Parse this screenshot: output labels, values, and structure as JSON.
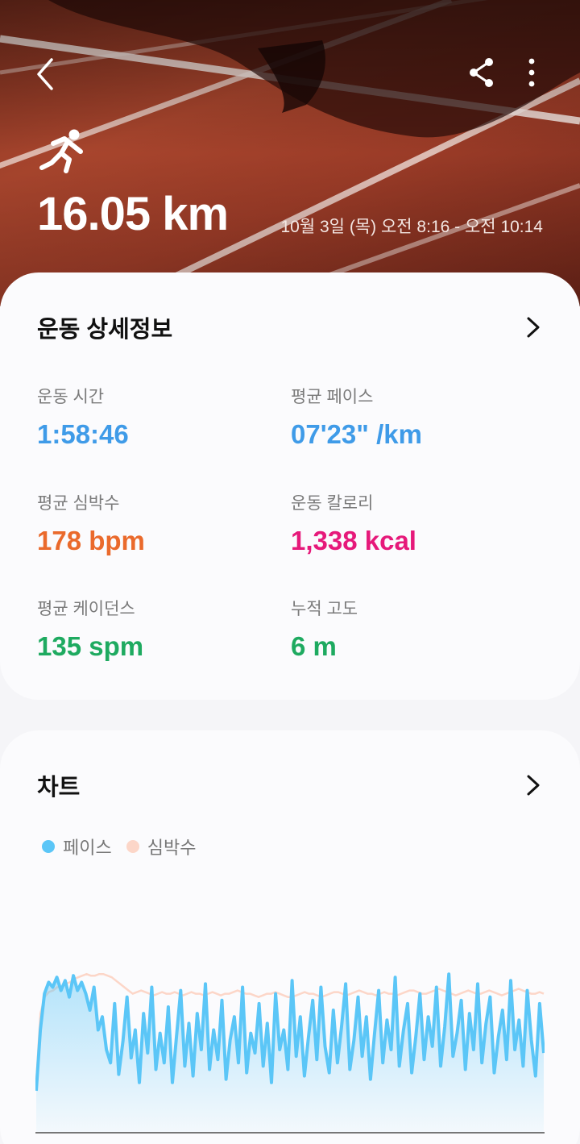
{
  "colors": {
    "pace": "#3f9be8",
    "heart": "#ea6a2c",
    "calorie": "#e6197a",
    "green": "#1eaa60",
    "legend_pace": "#5bc6f7",
    "legend_heart": "#fcd6c8"
  },
  "header": {
    "back_icon": "chevron-left-icon",
    "share_icon": "share-icon",
    "more_icon": "more-vertical-icon",
    "activity_icon": "running-icon",
    "distance": "16.05 km",
    "timerange": "10월 3일 (목) 오전 8:16 - 오전 10:14"
  },
  "details": {
    "title": "운동 상세정보",
    "stats": [
      {
        "label": "운동 시간",
        "value": "1:58:46",
        "color": "#3f9be8"
      },
      {
        "label": "평균 페이스",
        "value": "07'23\" /km",
        "color": "#3f9be8"
      },
      {
        "label": "평균 심박수",
        "value": "178 bpm",
        "color": "#ea6a2c"
      },
      {
        "label": "운동 칼로리",
        "value": "1,338 kcal",
        "color": "#e6197a"
      },
      {
        "label": "평균 케이던스",
        "value": "135 spm",
        "color": "#1eaa60"
      },
      {
        "label": "누적 고도",
        "value": "6 m",
        "color": "#1eaa60"
      }
    ]
  },
  "chart": {
    "title": "차트",
    "legend": [
      "페이스",
      "심박수"
    ]
  },
  "chart_data": {
    "type": "line",
    "title": "",
    "xlabel": "",
    "ylabel": "",
    "grid": false,
    "legend_position": "top-left",
    "series": [
      {
        "name": "페이스",
        "values": [
          0.25,
          0.62,
          0.84,
          0.91,
          0.88,
          0.94,
          0.86,
          0.92,
          0.82,
          0.95,
          0.86,
          0.91,
          0.84,
          0.74,
          0.88,
          0.62,
          0.7,
          0.5,
          0.42,
          0.78,
          0.35,
          0.55,
          0.82,
          0.45,
          0.62,
          0.3,
          0.72,
          0.48,
          0.88,
          0.38,
          0.6,
          0.42,
          0.76,
          0.3,
          0.58,
          0.86,
          0.4,
          0.66,
          0.34,
          0.72,
          0.5,
          0.9,
          0.38,
          0.62,
          0.44,
          0.8,
          0.32,
          0.56,
          0.7,
          0.42,
          0.88,
          0.36,
          0.6,
          0.48,
          0.78,
          0.4,
          0.66,
          0.3,
          0.84,
          0.5,
          0.62,
          0.38,
          0.92,
          0.46,
          0.7,
          0.34,
          0.58,
          0.8,
          0.44,
          0.88,
          0.52,
          0.36,
          0.74,
          0.42,
          0.64,
          0.9,
          0.38,
          0.56,
          0.82,
          0.46,
          0.7,
          0.32,
          0.6,
          0.86,
          0.42,
          0.68,
          0.5,
          0.94,
          0.4,
          0.62,
          0.78,
          0.36,
          0.58,
          0.84,
          0.44,
          0.7,
          0.52,
          0.88,
          0.4,
          0.64,
          0.96,
          0.46,
          0.6,
          0.8,
          0.38,
          0.72,
          0.5,
          0.9,
          0.42,
          0.66,
          0.82,
          0.36,
          0.58,
          0.74,
          0.44,
          0.92,
          0.5,
          0.68,
          0.4,
          0.86,
          0.56,
          0.34,
          0.78,
          0.48
        ]
      },
      {
        "name": "심박수",
        "values": [
          0.3,
          0.72,
          0.82,
          0.85,
          0.86,
          0.88,
          0.88,
          0.9,
          0.91,
          0.93,
          0.94,
          0.95,
          0.96,
          0.95,
          0.95,
          0.96,
          0.96,
          0.95,
          0.94,
          0.92,
          0.9,
          0.88,
          0.86,
          0.84,
          0.85,
          0.86,
          0.85,
          0.84,
          0.83,
          0.84,
          0.85,
          0.84,
          0.84,
          0.85,
          0.84,
          0.83,
          0.84,
          0.85,
          0.84,
          0.84,
          0.83,
          0.84,
          0.85,
          0.84,
          0.83,
          0.84,
          0.84,
          0.85,
          0.86,
          0.85,
          0.84,
          0.84,
          0.83,
          0.82,
          0.83,
          0.84,
          0.84,
          0.85,
          0.84,
          0.83,
          0.82,
          0.82,
          0.83,
          0.84,
          0.85,
          0.84,
          0.84,
          0.83,
          0.82,
          0.83,
          0.84,
          0.85,
          0.85,
          0.84,
          0.83,
          0.84,
          0.85,
          0.86,
          0.85,
          0.84,
          0.84,
          0.83,
          0.84,
          0.85,
          0.84,
          0.84,
          0.83,
          0.84,
          0.85,
          0.86,
          0.86,
          0.85,
          0.84,
          0.84,
          0.85,
          0.86,
          0.87,
          0.86,
          0.85,
          0.84,
          0.83,
          0.84,
          0.85,
          0.86,
          0.85,
          0.84,
          0.84,
          0.85,
          0.86,
          0.85,
          0.84,
          0.83,
          0.84,
          0.85,
          0.86,
          0.87,
          0.86,
          0.85,
          0.84,
          0.84,
          0.85,
          0.84
        ]
      }
    ]
  }
}
